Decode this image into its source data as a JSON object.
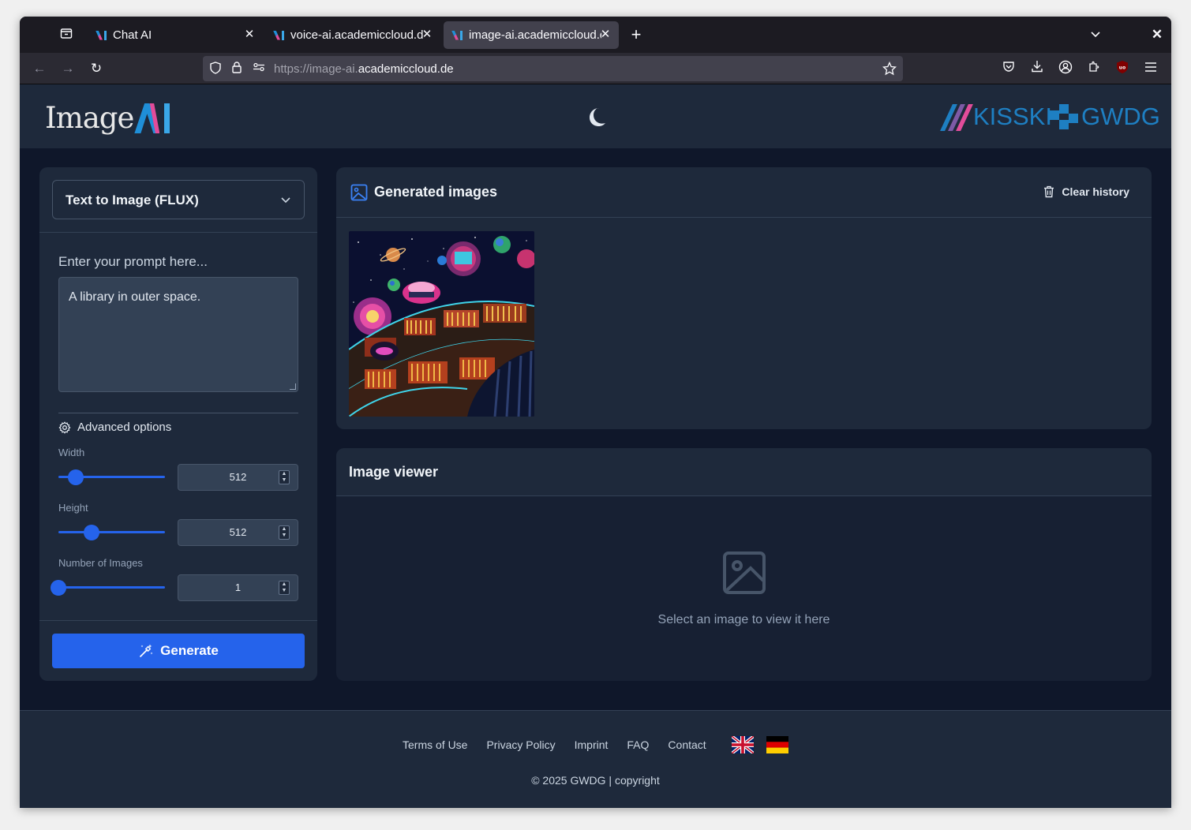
{
  "browser": {
    "tabs": [
      {
        "label": "Chat AI",
        "active": false
      },
      {
        "label": "voice-ai.academiccloud.de",
        "active": false
      },
      {
        "label": "image-ai.academiccloud.de",
        "active": true
      }
    ],
    "url_prefix": "https://image-ai.",
    "url_domain": "academiccloud.de"
  },
  "header": {
    "logo_text": "Image",
    "theme_icon": "moon-icon",
    "partners": [
      "KISSKI",
      "GWDG"
    ]
  },
  "controls": {
    "model_select": "Text to Image (FLUX)",
    "prompt_label": "Enter your prompt here...",
    "prompt_value": "A library in outer space.",
    "advanced_label": "Advanced options",
    "width_label": "Width",
    "width_value": "512",
    "width_fraction": 0.16,
    "height_label": "Height",
    "height_value": "512",
    "height_fraction": 0.31,
    "count_label": "Number of Images",
    "count_value": "1",
    "count_fraction": 0.0,
    "generate_label": "Generate"
  },
  "gallery": {
    "title": "Generated images",
    "clear_label": "Clear history"
  },
  "viewer": {
    "title": "Image viewer",
    "hint": "Select an image to view it here"
  },
  "footer": {
    "links": [
      "Terms of Use",
      "Privacy Policy",
      "Imprint",
      "FAQ",
      "Contact"
    ],
    "copyright": "© 2025 GWDG | copyright"
  },
  "colors": {
    "accent": "#2563eb",
    "page_bg": "#0f172a",
    "panel_bg": "#1e293b"
  }
}
